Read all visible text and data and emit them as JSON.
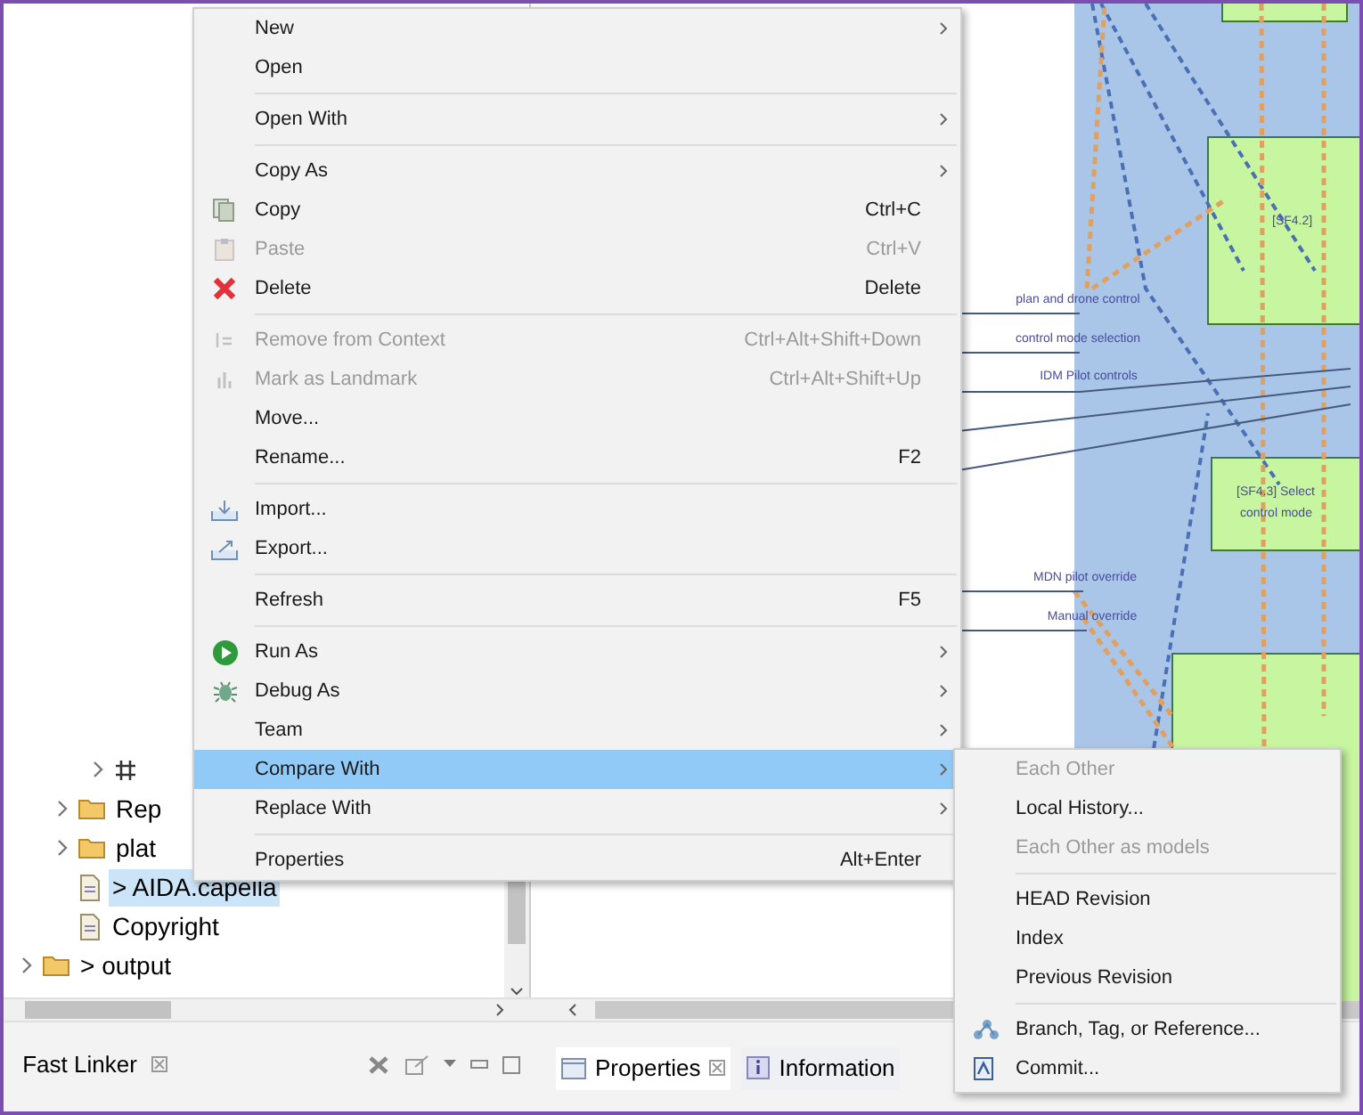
{
  "tree": {
    "items": [
      {
        "children": [
          {
            "children": [
              {
                "expanded": false
              }
            ]
          },
          {
            "label": "Rep",
            "expanded": false,
            "selected": false
          },
          {
            "label": "plat",
            "expanded": false,
            "selected": false
          },
          {
            "label": "> AIDA.capella",
            "selected": true
          },
          {
            "label": "Copyright",
            "selected": false
          }
        ]
      },
      {
        "label": "> output",
        "expanded": false,
        "selected": false
      }
    ]
  },
  "fast_linker_tab": {
    "label": "Fast Linker"
  },
  "bottom_tabs": [
    {
      "label": "Properties",
      "selected": true
    },
    {
      "label": "Information",
      "selected": false
    }
  ],
  "diagram": {
    "labels": [
      "plan and drone control",
      "control mode selection",
      "IDM Pilot controls",
      "MDN pilot override",
      "Manual override",
      "[SF4.2]",
      "[SF4.3] Select",
      "control mode"
    ]
  },
  "context_menu": {
    "items": [
      {
        "kind": "item",
        "label": "New",
        "submenu": true,
        "disabled": false,
        "selected": false
      },
      {
        "kind": "item",
        "label": "Open",
        "submenu": false,
        "disabled": false,
        "selected": false
      },
      {
        "kind": "separator"
      },
      {
        "kind": "item",
        "label": "Open With",
        "submenu": true,
        "disabled": false,
        "selected": false
      },
      {
        "kind": "separator"
      },
      {
        "kind": "item",
        "label": "Copy As",
        "submenu": true,
        "disabled": false,
        "selected": false
      },
      {
        "kind": "item",
        "label": "Copy",
        "shortcut": "Ctrl+C",
        "submenu": false,
        "disabled": false,
        "selected": false
      },
      {
        "kind": "item",
        "label": "Paste",
        "shortcut": "Ctrl+V",
        "submenu": false,
        "disabled": true,
        "selected": false
      },
      {
        "kind": "item",
        "label": "Delete",
        "shortcut": "Delete",
        "submenu": false,
        "disabled": false,
        "selected": false
      },
      {
        "kind": "separator"
      },
      {
        "kind": "item",
        "label": "Remove from Context",
        "shortcut": "Ctrl+Alt+Shift+Down",
        "submenu": false,
        "disabled": true,
        "selected": false
      },
      {
        "kind": "item",
        "label": "Mark as Landmark",
        "shortcut": "Ctrl+Alt+Shift+Up",
        "submenu": false,
        "disabled": true,
        "selected": false
      },
      {
        "kind": "item",
        "label": "Move...",
        "submenu": false,
        "disabled": false,
        "selected": false
      },
      {
        "kind": "item",
        "label": "Rename...",
        "shortcut": "F2",
        "submenu": false,
        "disabled": false,
        "selected": false
      },
      {
        "kind": "separator"
      },
      {
        "kind": "item",
        "label": "Import...",
        "submenu": false,
        "disabled": false,
        "selected": false
      },
      {
        "kind": "item",
        "label": "Export...",
        "submenu": false,
        "disabled": false,
        "selected": false
      },
      {
        "kind": "separator"
      },
      {
        "kind": "item",
        "label": "Refresh",
        "shortcut": "F5",
        "submenu": false,
        "disabled": false,
        "selected": false
      },
      {
        "kind": "separator"
      },
      {
        "kind": "item",
        "label": "Run As",
        "submenu": true,
        "disabled": false,
        "selected": false
      },
      {
        "kind": "item",
        "label": "Debug As",
        "submenu": true,
        "disabled": false,
        "selected": false
      },
      {
        "kind": "item",
        "label": "Team",
        "submenu": true,
        "disabled": false,
        "selected": false
      },
      {
        "kind": "item",
        "label": "Compare With",
        "submenu": true,
        "disabled": false,
        "selected": true
      },
      {
        "kind": "item",
        "label": "Replace With",
        "submenu": true,
        "disabled": false,
        "selected": false
      },
      {
        "kind": "separator"
      },
      {
        "kind": "item",
        "label": "Properties",
        "shortcut": "Alt+Enter",
        "submenu": false,
        "disabled": false,
        "selected": false
      }
    ]
  },
  "submenu": {
    "items": [
      {
        "kind": "item",
        "label": "Each Other",
        "disabled": true,
        "selected": false
      },
      {
        "kind": "item",
        "label": "Local History...",
        "disabled": false,
        "selected": false
      },
      {
        "kind": "item",
        "label": "Each Other as models",
        "disabled": true,
        "selected": false
      },
      {
        "kind": "separator"
      },
      {
        "kind": "item",
        "label": "HEAD Revision",
        "disabled": false,
        "selected": false
      },
      {
        "kind": "item",
        "label": "Index",
        "disabled": false,
        "selected": false
      },
      {
        "kind": "item",
        "label": "Previous Revision",
        "disabled": false,
        "selected": false
      },
      {
        "kind": "separator"
      },
      {
        "kind": "item",
        "label": "Branch, Tag, or Reference...",
        "disabled": false,
        "selected": false
      },
      {
        "kind": "item",
        "label": "Commit...",
        "disabled": false,
        "selected": false
      }
    ]
  }
}
